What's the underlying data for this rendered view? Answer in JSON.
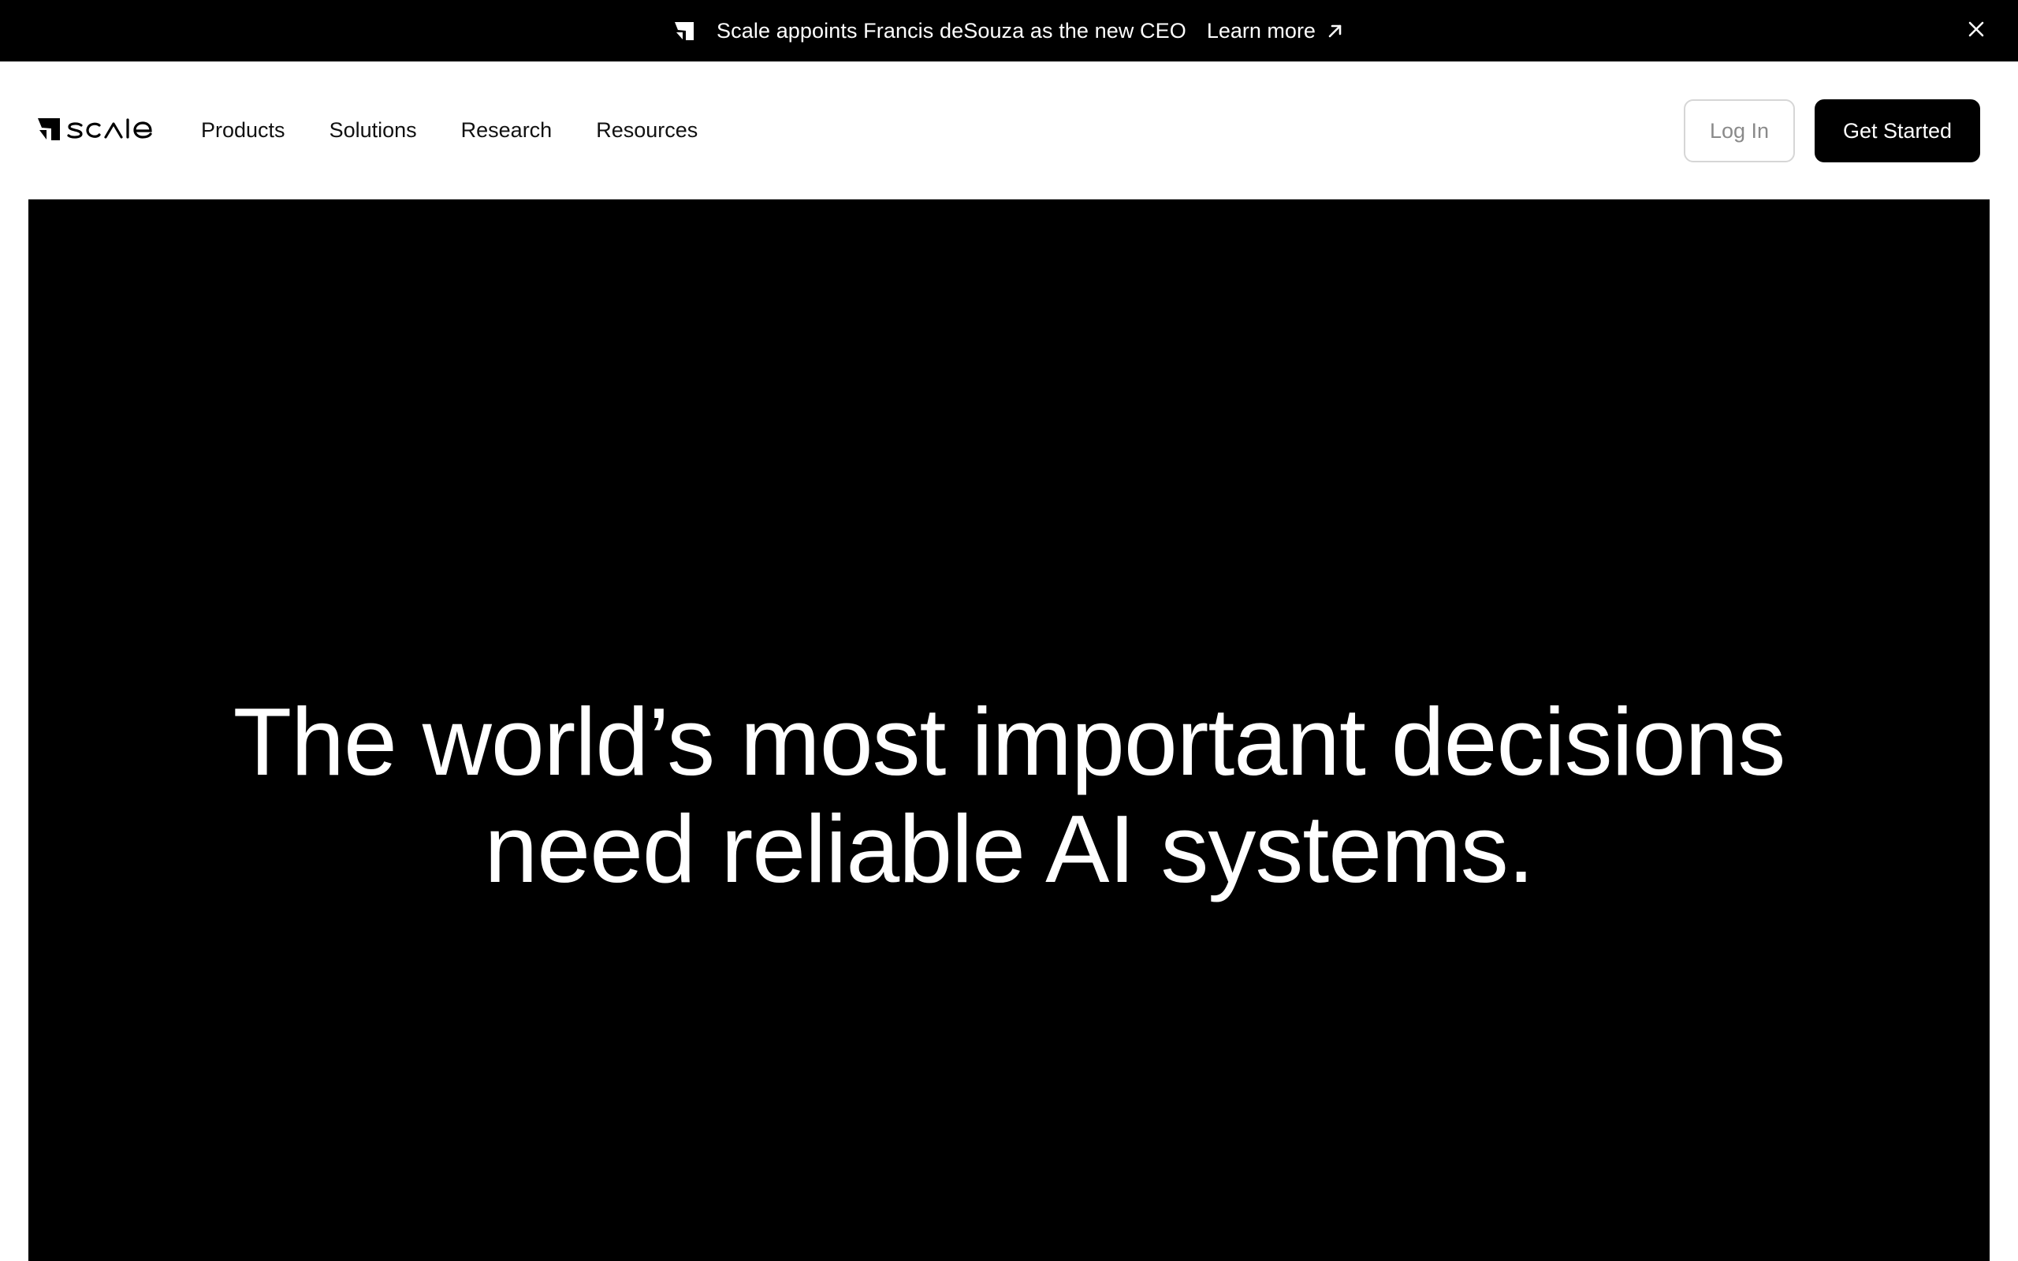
{
  "announcement": {
    "text": "Scale appoints Francis deSouza as the new CEO",
    "link_label": "Learn more",
    "icons": {
      "logo": "scale-mark-icon",
      "arrow": "arrow-up-right-icon",
      "close": "close-icon"
    }
  },
  "header": {
    "logo_text": "scale",
    "nav": [
      {
        "label": "Products"
      },
      {
        "label": "Solutions"
      },
      {
        "label": "Research"
      },
      {
        "label": "Resources"
      }
    ],
    "login_label": "Log In",
    "cta_label": "Get Started"
  },
  "hero": {
    "title_line1": "The world’s most important decisions",
    "title_line2": "need reliable AI systems."
  },
  "colors": {
    "background": "#000000",
    "foreground": "#ffffff",
    "login_border": "#d6d6d6",
    "login_text": "#8a8a8a"
  }
}
